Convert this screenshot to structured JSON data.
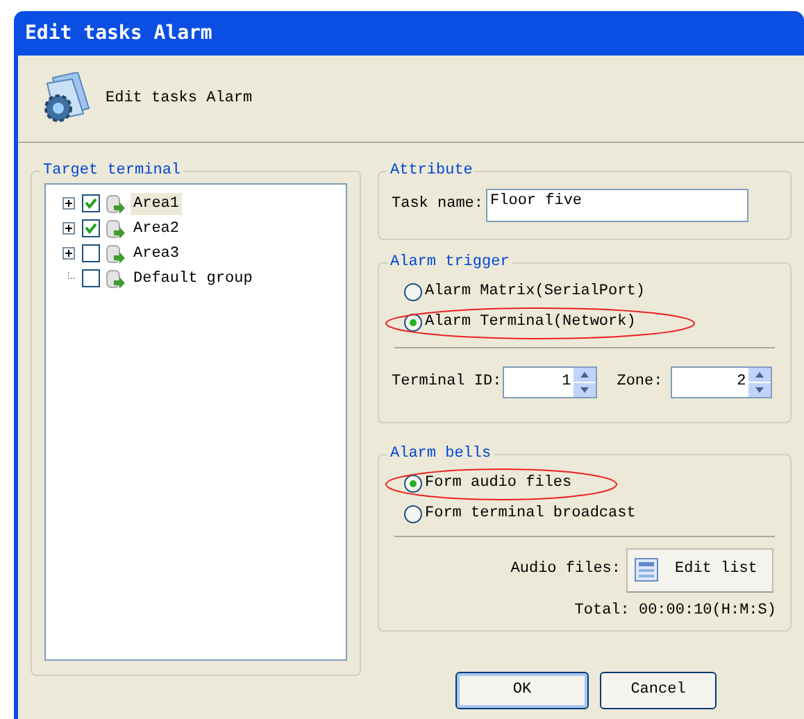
{
  "window": {
    "title": "Edit tasks Alarm"
  },
  "header": {
    "title": "Edit tasks Alarm"
  },
  "target_terminal": {
    "title": "Target terminal",
    "tree": [
      {
        "label": "Area1",
        "checked": true,
        "expandable": true,
        "selected": true
      },
      {
        "label": "Area2",
        "checked": true,
        "expandable": true,
        "selected": false
      },
      {
        "label": "Area3",
        "checked": false,
        "expandable": true,
        "selected": false
      },
      {
        "label": "Default group",
        "checked": false,
        "expandable": false,
        "selected": false
      }
    ]
  },
  "attribute": {
    "title": "Attribute",
    "task_name_label": "Task name:",
    "task_name": "Floor five"
  },
  "alarm_trigger": {
    "title": "Alarm trigger",
    "options": [
      {
        "label": "Alarm Matrix(SerialPort)",
        "selected": false,
        "circled": false
      },
      {
        "label": "Alarm Terminal(Network)",
        "selected": true,
        "circled": true
      }
    ],
    "terminal_id_label": "Terminal ID:",
    "terminal_id": "1",
    "zone_label": "Zone:",
    "zone": "2"
  },
  "alarm_bells": {
    "title": "Alarm bells",
    "options": [
      {
        "label": "Form audio files",
        "selected": true,
        "circled": true
      },
      {
        "label": "Form terminal broadcast",
        "selected": false,
        "circled": false
      }
    ],
    "audio_files_label": "Audio files:",
    "edit_list_button": "Edit list",
    "total": "Total: 00:00:10(H:M:S)"
  },
  "buttons": [
    "OK",
    "Cancel"
  ]
}
